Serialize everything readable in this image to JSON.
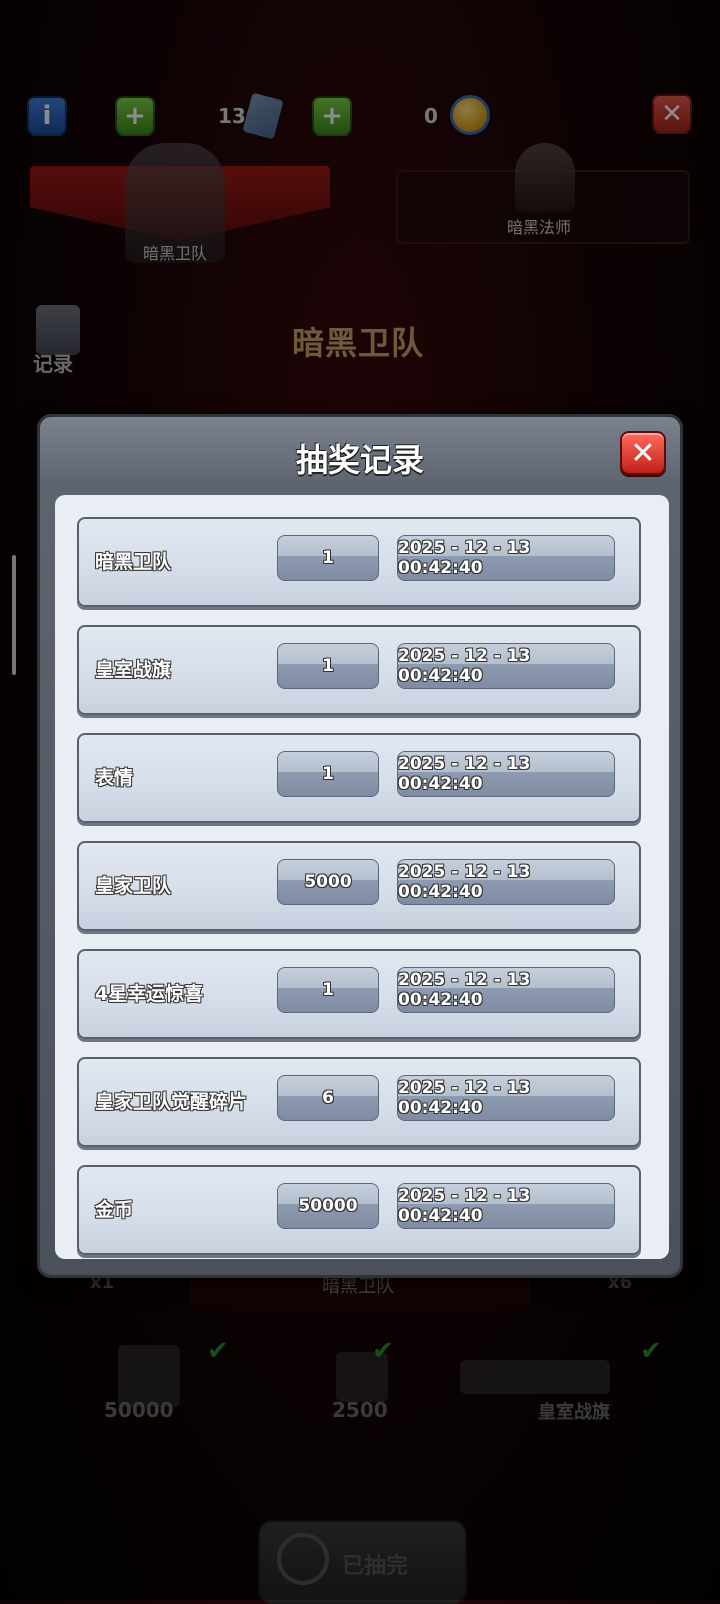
{
  "top_bar": {
    "ticket_count": "13",
    "coin_count": "0"
  },
  "tabs": [
    {
      "label": "暗黑卫队"
    },
    {
      "label": "暗黑法师"
    }
  ],
  "side": {
    "record_label": "记录"
  },
  "background_title": "暗黑卫队",
  "bottom": {
    "name": "暗黑卫队",
    "left_multiplier": "x1",
    "right_multiplier": "x6",
    "rewards": [
      {
        "value": "50000"
      },
      {
        "value": "2500"
      },
      {
        "value": "皇室战旗"
      }
    ],
    "drawn_label": "已抽完"
  },
  "modal": {
    "title": "抽奖记录",
    "records": [
      {
        "name": "暗黑卫队",
        "qty": "1",
        "time": "2025 - 12 - 13  00:42:40"
      },
      {
        "name": "皇室战旗",
        "qty": "1",
        "time": "2025 - 12 - 13  00:42:40"
      },
      {
        "name": "表情",
        "qty": "1",
        "time": "2025 - 12 - 13  00:42:40"
      },
      {
        "name": "皇家卫队",
        "qty": "5000",
        "time": "2025 - 12 - 13  00:42:40"
      },
      {
        "name": "4星幸运惊喜",
        "qty": "1",
        "time": "2025 - 12 - 13  00:42:40"
      },
      {
        "name": "皇家卫队觉醒碎片",
        "qty": "6",
        "time": "2025 - 12 - 13  00:42:40"
      },
      {
        "name": "金币",
        "qty": "50000",
        "time": "2025 - 12 - 13  00:42:40"
      }
    ]
  }
}
